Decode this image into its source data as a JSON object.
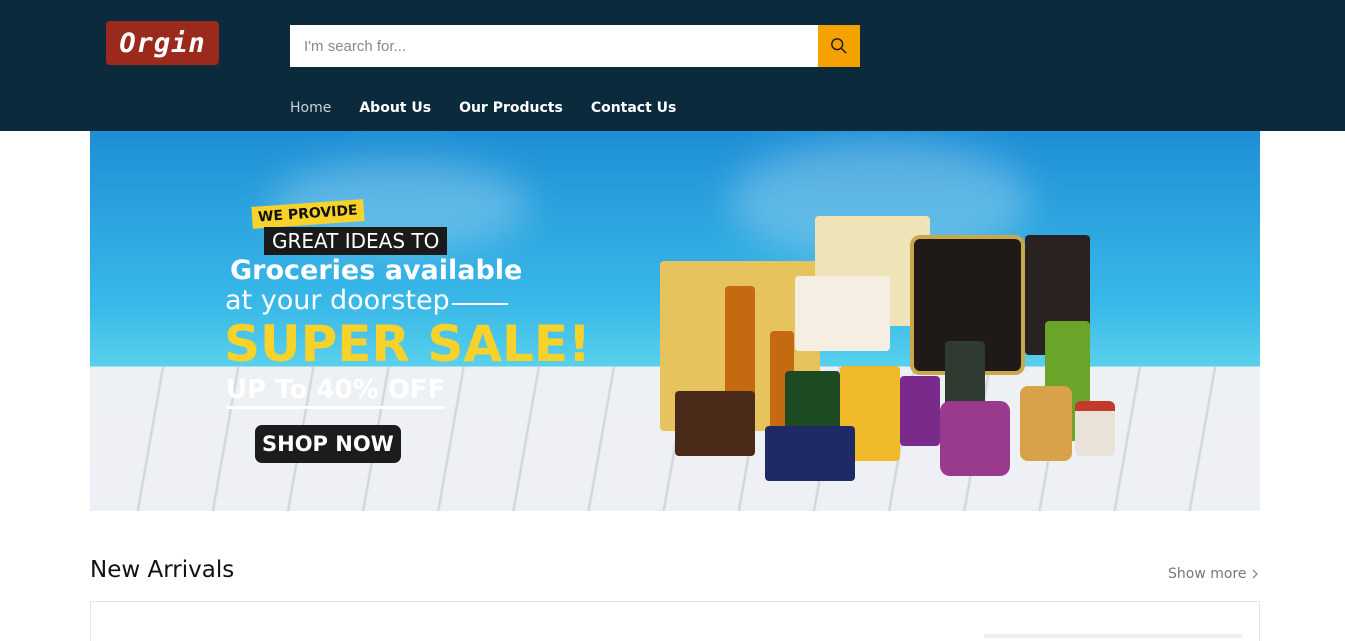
{
  "brand": {
    "logo_text": "Orgin"
  },
  "search": {
    "placeholder": "I'm search for...",
    "value": "",
    "icon": "search-icon"
  },
  "nav": {
    "items": [
      {
        "label": "Home",
        "active": true
      },
      {
        "label": "About Us"
      },
      {
        "label": "Our Products"
      },
      {
        "label": "Contact Us"
      }
    ]
  },
  "banner": {
    "tag1": "WE PROVIDE",
    "tag2": "GREAT IDEAS TO",
    "line1": "Groceries available",
    "line2": "at your doorstep",
    "headline": "SUPER SALE!",
    "offer": "UP To  40% OFF",
    "cta": "SHOP NOW"
  },
  "new_arrivals": {
    "title": "New Arrivals",
    "show_more": "Show more"
  },
  "colors": {
    "header_bg": "#0b2a3c",
    "accent": "#f5a200",
    "logo_bg": "#9b2a1c",
    "sale_yellow": "#f7d22a"
  }
}
